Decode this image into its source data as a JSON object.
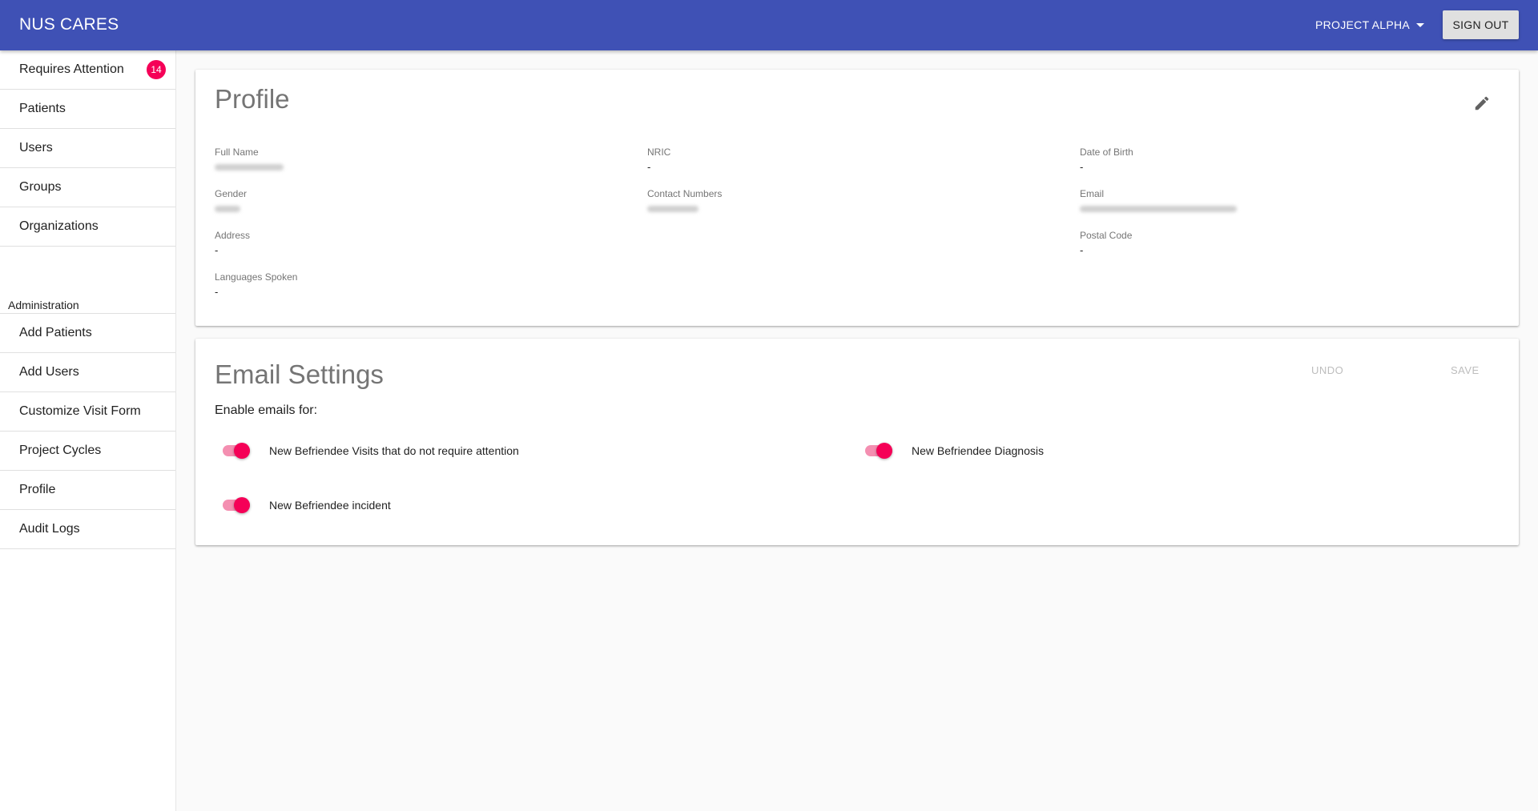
{
  "header": {
    "app_title": "NUS CARES",
    "project_selector": "PROJECT ALPHA",
    "sign_out_label": "SIGN OUT"
  },
  "sidebar": {
    "items": [
      {
        "label": "Requires Attention",
        "badge": "14"
      },
      {
        "label": "Patients"
      },
      {
        "label": "Users"
      },
      {
        "label": "Groups"
      },
      {
        "label": "Organizations"
      }
    ],
    "admin_section_label": "Administration",
    "admin_items": [
      {
        "label": "Add Patients"
      },
      {
        "label": "Add Users"
      },
      {
        "label": "Customize Visit Form"
      },
      {
        "label": "Project Cycles"
      },
      {
        "label": "Profile"
      },
      {
        "label": "Audit Logs"
      }
    ]
  },
  "profile": {
    "title": "Profile",
    "fields": {
      "full_name": {
        "label": "Full Name"
      },
      "nric": {
        "label": "NRIC",
        "value": "-"
      },
      "date_of_birth": {
        "label": "Date of Birth",
        "value": "-"
      },
      "gender": {
        "label": "Gender"
      },
      "contact_numbers": {
        "label": "Contact Numbers"
      },
      "email": {
        "label": "Email"
      },
      "address": {
        "label": "Address",
        "value": "-"
      },
      "postal_code": {
        "label": "Postal Code",
        "value": "-"
      },
      "languages_spoken": {
        "label": "Languages Spoken",
        "value": "-"
      }
    }
  },
  "email_settings": {
    "title": "Email Settings",
    "undo_label": "UNDO",
    "save_label": "SAVE",
    "subhead": "Enable emails for:",
    "toggles": [
      {
        "label": "New Befriendee Visits that do not require attention",
        "enabled": true
      },
      {
        "label": "New Befriendee Diagnosis",
        "enabled": true
      },
      {
        "label": "New Befriendee incident",
        "enabled": true
      }
    ]
  },
  "colors": {
    "app_bar": "#3f51b5",
    "accent": "#f50057",
    "switch_track": "#f48fb1"
  },
  "icons": {
    "edit": "pencil-icon",
    "project_dropdown": "caret-down-icon"
  }
}
